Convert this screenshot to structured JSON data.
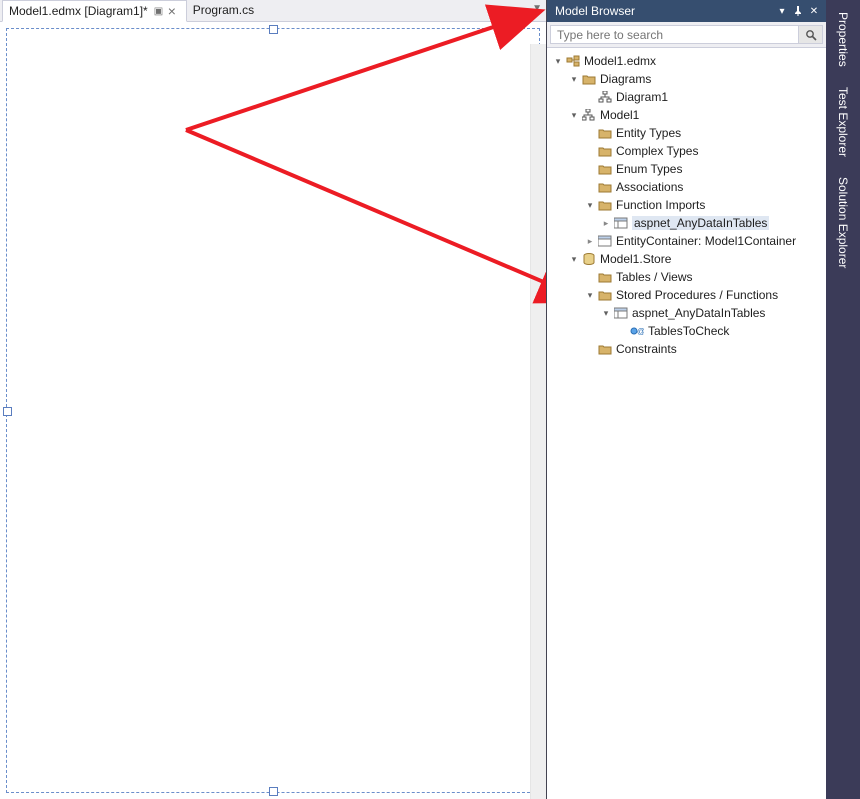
{
  "tabs": {
    "active": "Model1.edmx [Diagram1]*",
    "other": "Program.cs"
  },
  "modelBrowser": {
    "title": "Model Browser",
    "search_placeholder": "Type here to search"
  },
  "tree": {
    "root": "Model1.edmx",
    "diagrams": "Diagrams",
    "diagram1": "Diagram1",
    "model1": "Model1",
    "entityTypes": "Entity Types",
    "complexTypes": "Complex Types",
    "enumTypes": "Enum Types",
    "associations": "Associations",
    "functionImports": "Function Imports",
    "fi_item": "aspnet_AnyDataInTables",
    "entityContainer": "EntityContainer: Model1Container",
    "store": "Model1.Store",
    "tablesViews": "Tables / Views",
    "spFunctions": "Stored Procedures / Functions",
    "sp_item": "aspnet_AnyDataInTables",
    "sp_param": "TablesToCheck",
    "constraints": "Constraints"
  },
  "sidetabs": {
    "properties": "Properties",
    "testExplorer": "Test Explorer",
    "solutionExplorer": "Solution Explorer"
  }
}
